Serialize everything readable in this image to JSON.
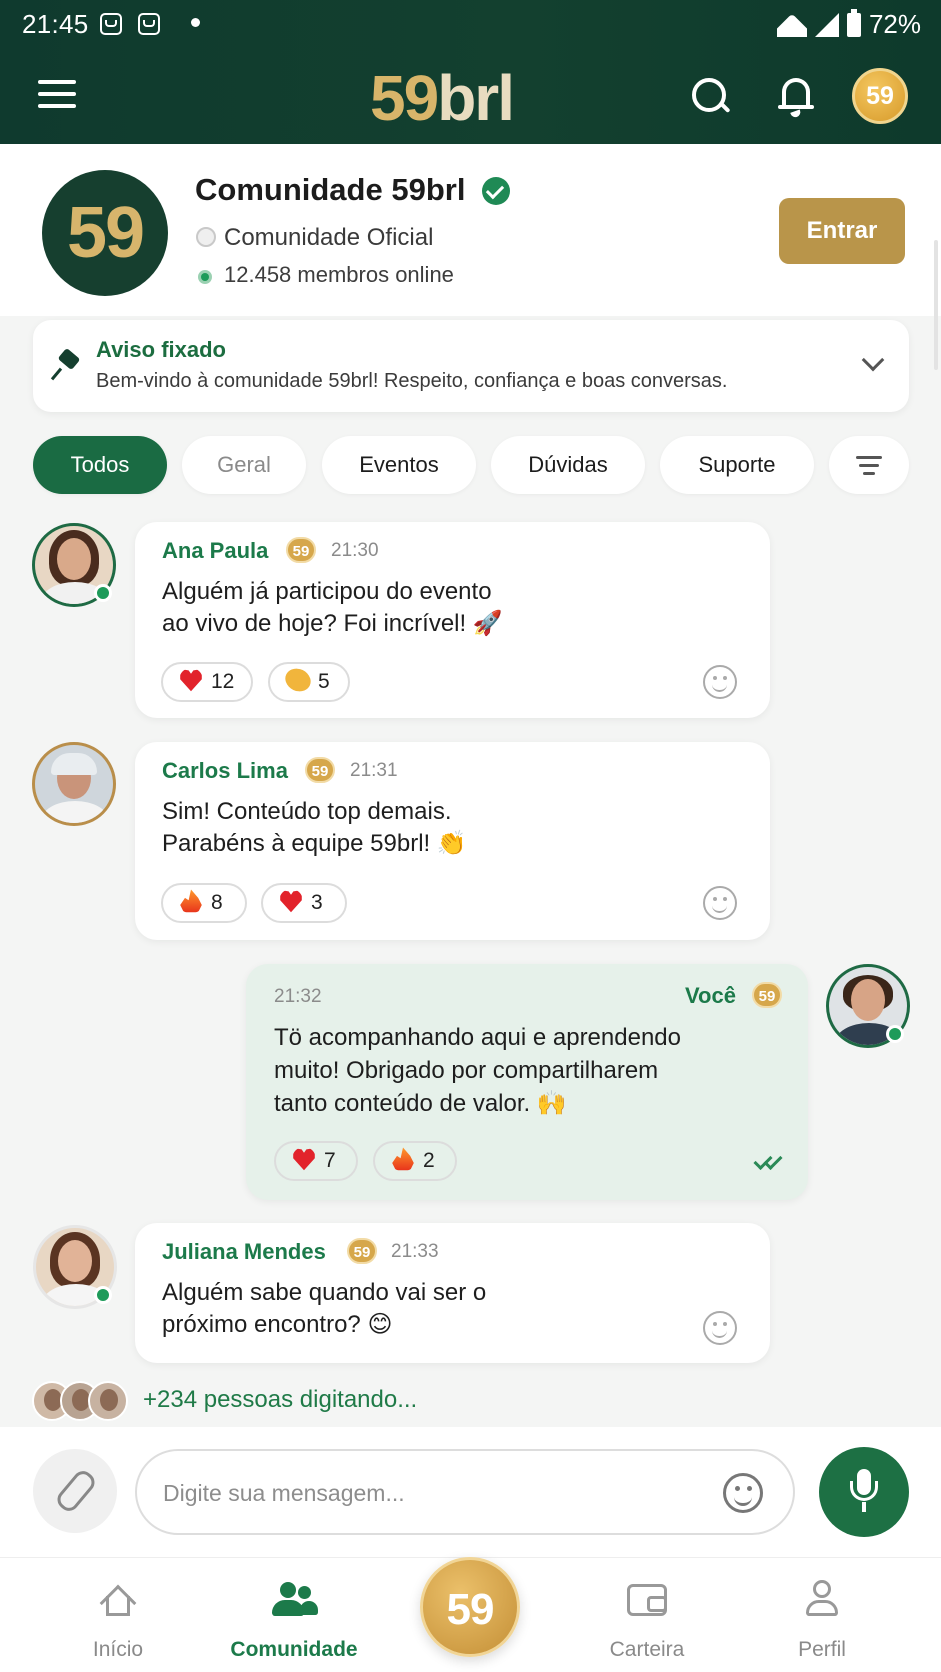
{
  "status_bar": {
    "time": "21:45",
    "battery": "72%"
  },
  "app": {
    "logo_number": "59",
    "logo_text": "brl",
    "header_badge": "59"
  },
  "community": {
    "logo": "59",
    "title": "Comunidade 59brl",
    "subtitle": "Comunidade Oficial",
    "members_online": "12.458 membros online",
    "join_label": "Entrar"
  },
  "pinned": {
    "title": "Aviso fixado",
    "text": "Bem-vindo à comunidade 59brl! Respeito, confiança e boas conversas."
  },
  "tabs": [
    "Todos",
    "Geral",
    "Eventos",
    "Dúvidas",
    "Suporte"
  ],
  "messages": [
    {
      "author": "Ana Paula",
      "badge": "59",
      "time": "21:30",
      "lines": [
        "Alguém já participou do evento",
        "ao vivo de hoje? Foi incrível! 🚀"
      ],
      "reactions": [
        {
          "icon": "heart-icon",
          "count": "12"
        },
        {
          "icon": "clap-icon",
          "count": "5"
        }
      ]
    },
    {
      "author": "Carlos Lima",
      "badge": "59",
      "time": "21:31",
      "lines": [
        "Sim! Conteúdo top demais.",
        "Parabéns à equipe 59brl! 👏"
      ],
      "reactions": [
        {
          "icon": "fire-icon",
          "count": "8"
        },
        {
          "icon": "heart-icon",
          "count": "3"
        }
      ]
    },
    {
      "author": "Você",
      "badge": "59",
      "time": "21:32",
      "lines": [
        "Tö acompanhando aqui e aprendendo",
        "muito! Obrigado por compartilharem",
        "tanto conteúdo de valor. 🙌"
      ],
      "reactions": [
        {
          "icon": "heart-icon",
          "count": "7"
        },
        {
          "icon": "fire-icon",
          "count": "2"
        }
      ]
    },
    {
      "author": "Juliana Mendes",
      "badge": "59",
      "time": "21:33",
      "lines": [
        "Alguém sabe quando vai ser o",
        "próximo encontro? 😊"
      ],
      "reactions": []
    }
  ],
  "typing": {
    "text": "+234 pessoas digitando..."
  },
  "composer": {
    "placeholder": "Digite sua mensagem..."
  },
  "bottom_nav": {
    "items": [
      "Início",
      "Comunidade",
      "Carteira",
      "Perfil"
    ],
    "center_coin": "59",
    "active": "Comunidade"
  },
  "colors": {
    "brand_green": "#1a6b43",
    "header_bg": "#0f3a2e",
    "gold": "#b9954a"
  }
}
